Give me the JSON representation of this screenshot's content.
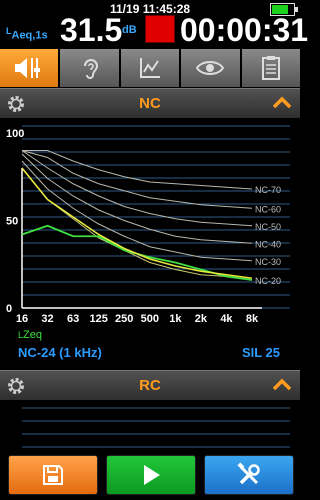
{
  "status": {
    "metric_main": "L",
    "metric_sub": "Aeq,1s",
    "level": "31.5",
    "unit": "dB",
    "date_time": "11/19 11:45:28",
    "timer": "00:00:31"
  },
  "tabs": [
    {
      "icon": "level-meter-icon",
      "active": true
    },
    {
      "icon": "ear-icon",
      "active": false
    },
    {
      "icon": "graph-icon",
      "active": false
    },
    {
      "icon": "eye-icon",
      "active": false
    },
    {
      "icon": "clipboard-icon",
      "active": false
    }
  ],
  "nc_panel": {
    "title": "NC",
    "result": "NC-24 (1 kHz)",
    "sil": "SIL 25",
    "series_label": "LZeq"
  },
  "rc_panel": {
    "title": "RC"
  },
  "chart_data": {
    "type": "line",
    "title": "NC",
    "categories": [
      "16",
      "32",
      "63",
      "125",
      "250",
      "500",
      "1k",
      "2k",
      "4k",
      "8k"
    ],
    "ylim": [
      0,
      100
    ],
    "y_ticks": [
      0,
      50,
      100
    ],
    "grid": true,
    "series": [
      {
        "name": "NC-70",
        "values": [
          90,
          90,
          84,
          79,
          75,
          72,
          71,
          70,
          69,
          68
        ]
      },
      {
        "name": "NC-60",
        "values": [
          90,
          86,
          77,
          71,
          67,
          63,
          61,
          59,
          58,
          57
        ]
      },
      {
        "name": "NC-50",
        "values": [
          90,
          80,
          71,
          64,
          58,
          54,
          51,
          49,
          48,
          47
        ]
      },
      {
        "name": "NC-40",
        "values": [
          88,
          74,
          64,
          56,
          50,
          45,
          41,
          39,
          38,
          37
        ]
      },
      {
        "name": "NC-30",
        "values": [
          84,
          68,
          57,
          48,
          41,
          35,
          32,
          29,
          28,
          27
        ]
      },
      {
        "name": "NC-20",
        "values": [
          80,
          62,
          51,
          40,
          33,
          26,
          22,
          19,
          18,
          16
        ]
      },
      {
        "name": "LZeq",
        "values": [
          42,
          47,
          41,
          41,
          33,
          29,
          26,
          22,
          18,
          16
        ]
      },
      {
        "name": "",
        "values": [
          80,
          62,
          52,
          42,
          34,
          28,
          24,
          21,
          19,
          17
        ]
      }
    ],
    "colors": {
      "nc_curve": "#b9b7aa",
      "nc_lowest": "#c8c870",
      "measured": "#3fe03f",
      "reference": "#e8e840"
    }
  }
}
